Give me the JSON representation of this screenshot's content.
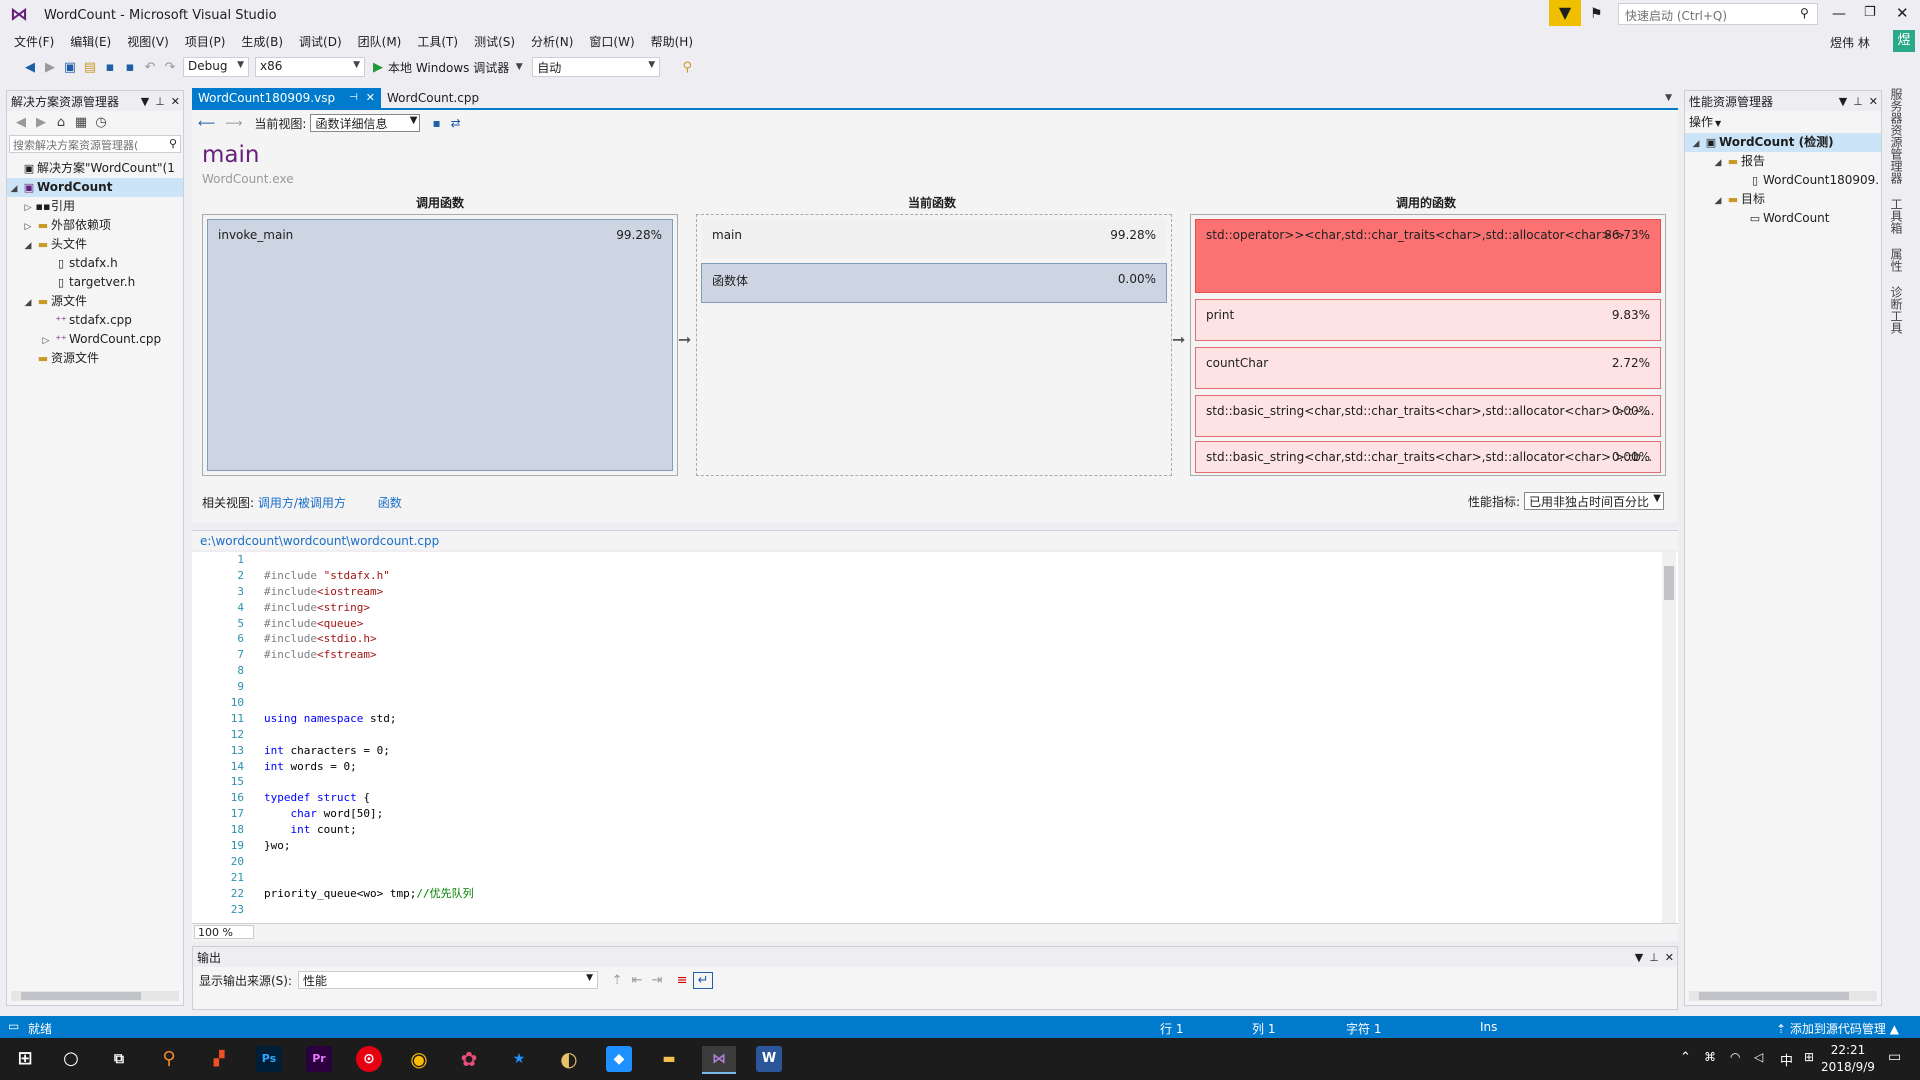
{
  "window": {
    "title": "WordCount - Microsoft Visual Studio",
    "quick_launch_placeholder": "快速启动 (Ctrl+Q)",
    "user_name": "煜伟 林",
    "user_initial": "煜"
  },
  "menu": [
    "文件(F)",
    "编辑(E)",
    "视图(V)",
    "项目(P)",
    "生成(B)",
    "调试(D)",
    "团队(M)",
    "工具(T)",
    "测试(S)",
    "分析(N)",
    "窗口(W)",
    "帮助(H)"
  ],
  "toolbar": {
    "config": "Debug",
    "platform": "x86",
    "run_label": "本地 Windows 调试器",
    "auto": "自动"
  },
  "solution_explorer": {
    "title": "解决方案资源管理器",
    "search_placeholder": "搜索解决方案资源管理器(",
    "solution": "解决方案\"WordCount\"(1",
    "project": "WordCount",
    "refs": "引用",
    "external_deps": "外部依赖项",
    "headers": "头文件",
    "header_files": [
      "stdafx.h",
      "targetver.h"
    ],
    "sources": "源文件",
    "source_files": [
      "stdafx.cpp",
      "WordCount.cpp"
    ],
    "resources": "资源文件"
  },
  "tabs": [
    {
      "label": "WordCount180909.vsp",
      "active": true
    },
    {
      "label": "WordCount.cpp",
      "active": false
    }
  ],
  "report": {
    "current_view_label": "当前视图:",
    "current_view": "函数详细信息",
    "function_name": "main",
    "exe": "WordCount.exe",
    "col_callers": "调用函数",
    "col_current": "当前函数",
    "col_callees": "调用的函数",
    "callers": [
      {
        "name": "invoke_main",
        "pct": "99.28%"
      }
    ],
    "current": [
      {
        "name": "main",
        "pct": "99.28%"
      },
      {
        "name": "函数体",
        "pct": "0.00%"
      }
    ],
    "callees": [
      {
        "name": "std::operator>><char,std::char_traits<char>,std::allocator<char> >",
        "pct": "86.73%"
      },
      {
        "name": "print",
        "pct": "9.83%"
      },
      {
        "name": "countChar",
        "pct": "2.72%"
      },
      {
        "name": "std::basic_string<char,std::char_traits<char>,std::allocator<char> >::~...",
        "pct": "0.00%"
      },
      {
        "name": "std::basic_string<char,std::char_traits<char>,std::allocator<char> >::b...",
        "pct": "0.00%"
      }
    ],
    "related_label": "相关视图:",
    "related_links": [
      "调用方/被调用方",
      "函数"
    ],
    "metric_label": "性能指标:",
    "metric_value": "已用非独占时间百分比"
  },
  "code": {
    "path": "e:\\wordcount\\wordcount\\wordcount.cpp",
    "zoom": "100 %",
    "line_numbers": [
      "1",
      "2",
      "3",
      "4",
      "5",
      "6",
      "7",
      "8",
      "9",
      "10",
      "11",
      "12",
      "13",
      "14",
      "15",
      "16",
      "17",
      "18",
      "19",
      "20",
      "21",
      "22",
      "23"
    ],
    "lines": [
      "",
      "#include \"stdafx.h\"",
      "#include<iostream>",
      "#include<string>",
      "#include<queue>",
      "#include<stdio.h>",
      "#include<fstream>",
      "",
      "",
      "",
      "using namespace std;",
      "",
      "int characters = 0;",
      "int words = 0;",
      "",
      "typedef struct {",
      "    char word[50];",
      "    int count;",
      "}wo;",
      "",
      "",
      "priority_queue<wo> tmp;//优先队列",
      ""
    ]
  },
  "output": {
    "title": "输出",
    "source_label": "显示输出来源(S):",
    "source_value": "性能"
  },
  "perf_explorer": {
    "title": "性能资源管理器",
    "ops": "操作",
    "root": "WordCount (检测)",
    "reports": "报告",
    "report_file": "WordCount180909.",
    "targets": "目标",
    "target_item": "WordCount"
  },
  "right_rail": [
    "服务器资源管理器",
    "工具箱",
    "属性",
    "诊断工具"
  ],
  "status": {
    "ready": "就绪",
    "line": "行 1",
    "col": "列 1",
    "char": "字符 1",
    "ins": "Ins",
    "source_control": "添加到源代码管理"
  },
  "taskbar": {
    "time": "22:21",
    "date": "2018/9/9",
    "ime": "中"
  }
}
